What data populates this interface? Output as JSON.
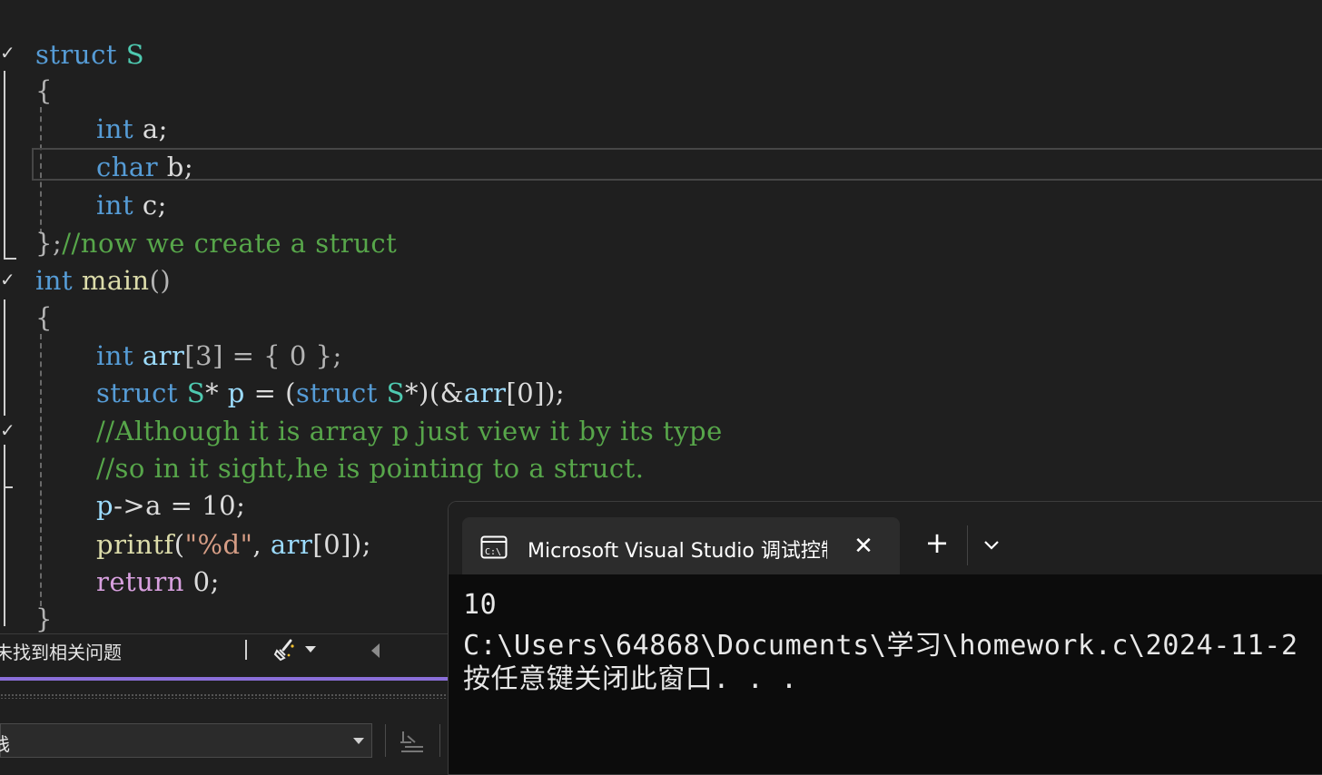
{
  "editor": {
    "lines": [
      [
        {
          "t": "struct",
          "c": "kw"
        },
        {
          "t": " "
        },
        {
          "t": "S",
          "c": "ty"
        }
      ],
      [
        {
          "t": "{",
          "c": "pn"
        }
      ],
      [
        {
          "t": "int",
          "c": "kw"
        },
        {
          "t": " a;"
        }
      ],
      [
        {
          "t": "char",
          "c": "kw"
        },
        {
          "t": " b;"
        }
      ],
      [
        {
          "t": "int",
          "c": "kw"
        },
        {
          "t": " c;"
        }
      ],
      [
        {
          "t": "};",
          "c": "pn"
        },
        {
          "t": "//now we create a struct",
          "c": "cm"
        }
      ],
      [
        {
          "t": "int",
          "c": "kw"
        },
        {
          "t": " "
        },
        {
          "t": "main",
          "c": "fn"
        },
        {
          "t": "()",
          "c": "pn"
        }
      ],
      [
        {
          "t": "{",
          "c": "pn"
        }
      ],
      [
        {
          "t": "int",
          "c": "kw"
        },
        {
          "t": " "
        },
        {
          "t": "arr",
          "c": "var"
        },
        {
          "t": "[3] = { 0 };",
          "c": "pn"
        }
      ],
      [
        {
          "t": "struct",
          "c": "kw"
        },
        {
          "t": " "
        },
        {
          "t": "S",
          "c": "ty"
        },
        {
          "t": "* "
        },
        {
          "t": "p",
          "c": "var"
        },
        {
          "t": " = ("
        },
        {
          "t": "struct",
          "c": "kw"
        },
        {
          "t": " "
        },
        {
          "t": "S",
          "c": "ty"
        },
        {
          "t": "*)(&"
        },
        {
          "t": "arr",
          "c": "var"
        },
        {
          "t": "[0]);"
        }
      ],
      [
        {
          "t": "//Although it is array p just view it by its type",
          "c": "cm"
        }
      ],
      [
        {
          "t": "//so in it sight,he is pointing to a struct.",
          "c": "cm"
        }
      ],
      [
        {
          "t": "p",
          "c": "var"
        },
        {
          "t": "->a = 10;"
        }
      ],
      [
        {
          "t": "printf",
          "c": "fn"
        },
        {
          "t": "("
        },
        {
          "t": "\"%d\"",
          "c": "str"
        },
        {
          "t": ", "
        },
        {
          "t": "arr",
          "c": "var"
        },
        {
          "t": "[0]);"
        }
      ],
      [
        {
          "t": "return",
          "c": "ctl"
        },
        {
          "t": " 0;"
        }
      ],
      [
        {
          "t": "}",
          "c": "pn"
        }
      ]
    ]
  },
  "status_bar": {
    "issues_text": "未找到相关问题"
  },
  "output_panel": {
    "source_selected": "栈"
  },
  "terminal": {
    "tab_title": "Microsoft Visual Studio 调试控制台",
    "tab_icon": "console-icon",
    "close_glyph": "✕",
    "new_tab_glyph": "+",
    "output_lines": [
      "10",
      "C:\\Users\\64868\\Documents\\学习\\homework.c\\2024-11-2",
      "按任意键关闭此窗口. . ."
    ]
  },
  "colors": {
    "keyword": "#569cd6",
    "type": "#4ec9b0",
    "function": "#dcdcaa",
    "variable": "#9cdcfe",
    "comment": "#57a64a",
    "control": "#d8a0df",
    "accent": "#8b6fd9"
  }
}
